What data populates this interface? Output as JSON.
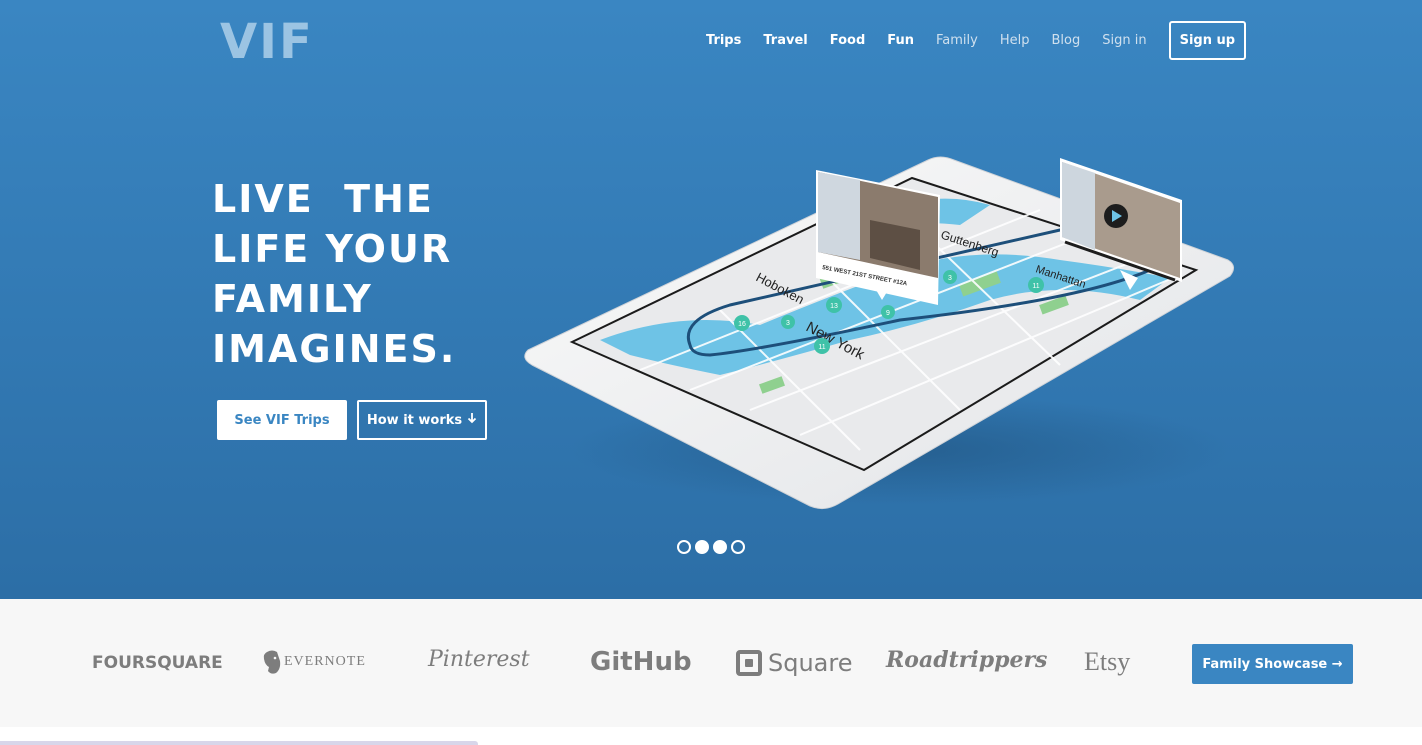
{
  "header": {
    "logo": "VIF",
    "nav": [
      {
        "label": "Trips"
      },
      {
        "label": "Travel"
      },
      {
        "label": "Food"
      },
      {
        "label": "Fun"
      },
      {
        "label": "Family"
      },
      {
        "label": "Help"
      },
      {
        "label": "Blog"
      },
      {
        "label": "Sign in"
      },
      {
        "label": "Sign up"
      }
    ]
  },
  "hero": {
    "headline_lines": [
      "LIVE  THE",
      "LIFE YOUR",
      "FAMILY",
      "IMAGINES."
    ],
    "primary_button": "See VIF Trips",
    "secondary_button": "How it works",
    "secondary_button_icon": "arrow-down-icon",
    "carousel": {
      "total": 4,
      "active": [
        2,
        3
      ]
    },
    "map": {
      "labels": [
        "Hoboken",
        "New York",
        "Guttenberg",
        "Manhattan"
      ],
      "card_title": "551 WEST 21ST STREET #12A",
      "pins": [
        "13",
        "16",
        "3",
        "9",
        "11",
        "3",
        "11"
      ]
    }
  },
  "partners": {
    "logos": [
      "FOURSQUARE",
      "EVERNOTE",
      "Pinterest",
      "GitHub",
      "Square",
      "Roadtrippers",
      "Etsy"
    ],
    "showcase_button": "Family Showcase →"
  },
  "colors": {
    "hero_blue": "#3a86c2",
    "logo_blue": "#9cc4e3",
    "partner_gray": "#7d7d7d",
    "partner_bg": "#f7f7f7"
  }
}
